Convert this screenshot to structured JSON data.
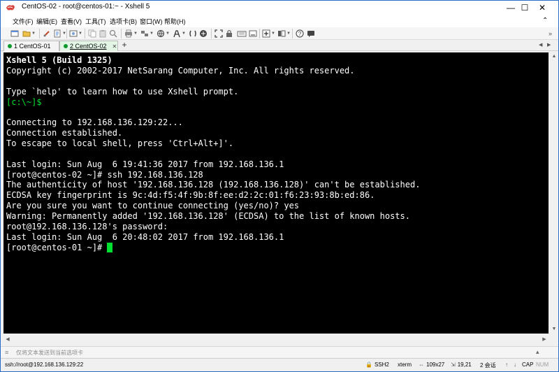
{
  "window": {
    "title": "CentOS-02 - root@centos-01:~ - Xshell 5",
    "controls": {
      "minimize": "—",
      "maximize": "☐",
      "close": "✕"
    }
  },
  "menu": [
    "文件(F)",
    "编辑(E)",
    "查看(V)",
    "工具(T)",
    "选项卡(B)",
    "窗口(W)",
    "帮助(H)"
  ],
  "tabs": [
    {
      "label": "1 CentOS-01",
      "status_color": "#0c9a2c",
      "active": false
    },
    {
      "label": "2 CentOS-02",
      "status_color": "#0c9a2c",
      "active": true
    }
  ],
  "terminal": {
    "lines": [
      "Xshell 5 (Build 1325)",
      "Copyright (c) 2002-2017 NetSarang Computer, Inc. All rights reserved.",
      "",
      "Type `help' to learn how to use Xshell prompt.",
      "[c:\\~]$",
      "",
      "Connecting to 192.168.136.129:22...",
      "Connection established.",
      "To escape to local shell, press 'Ctrl+Alt+]'.",
      "",
      "Last login: Sun Aug  6 19:41:36 2017 from 192.168.136.1",
      "[root@centos-02 ~]# ssh 192.168.136.128",
      "The authenticity of host '192.168.136.128 (192.168.136.128)' can't be established.",
      "ECDSA key fingerprint is 9c:4d:f5:4f:9b:8f:ee:d2:2c:01:f6:23:93:8b:ed:86.",
      "Are you sure you want to continue connecting (yes/no)? yes",
      "Warning: Permanently added '192.168.136.128' (ECDSA) to the list of known hosts.",
      "root@192.168.136.128's password:",
      "Last login: Sun Aug  6 20:48:02 2017 from 192.168.136.1",
      "[root@centos-01 ~]# "
    ],
    "background": "#000000",
    "foreground": "#ffffff",
    "prompt_color": "#00e030"
  },
  "compose": {
    "placeholder": "仅将文本发送到当前选项卡"
  },
  "status": {
    "connection": "ssh://root@192.168.136.129:22",
    "protocol": "SSH2",
    "terminal_type": "xterm",
    "size": "109x27",
    "cursor_pos": "19,21",
    "sessions": "2 会话",
    "cap": "CAP",
    "num": "NUM"
  }
}
